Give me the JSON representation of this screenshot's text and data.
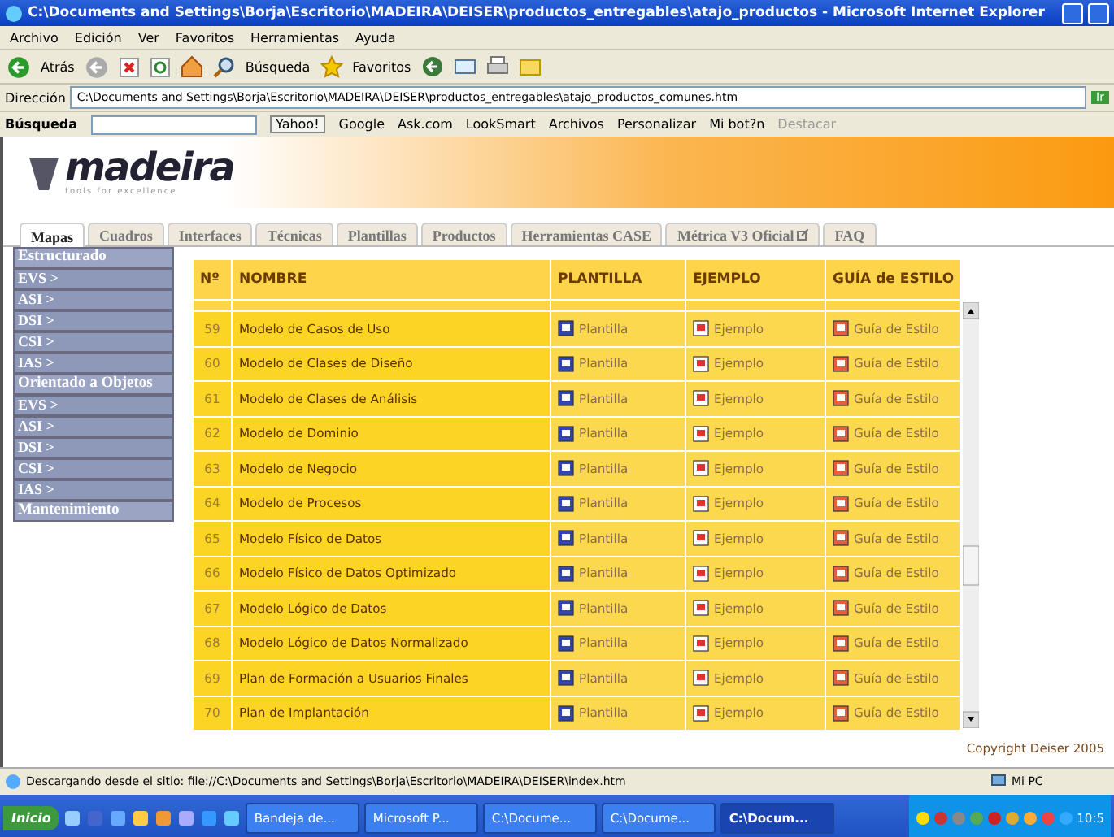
{
  "window": {
    "title": "C:\\Documents and Settings\\Borja\\Escritorio\\MADEIRA\\DEISER\\productos_entregables\\atajo_productos - Microsoft Internet Explorer"
  },
  "menu": [
    "Archivo",
    "Edición",
    "Ver",
    "Favoritos",
    "Herramientas",
    "Ayuda"
  ],
  "toolbar": {
    "back": "Atrás",
    "search": "Búsqueda",
    "favorites": "Favoritos"
  },
  "address": {
    "label": "Dirección",
    "value": "C:\\Documents and Settings\\Borja\\Escritorio\\MADEIRA\\DEISER\\productos_entregables\\atajo_productos_comunes.htm",
    "go": "Ir"
  },
  "search_bar": {
    "label": "Búsqueda",
    "engine": "Yahoo!",
    "links": [
      {
        "label": "Google",
        "disabled": false
      },
      {
        "label": "Ask.com",
        "disabled": false
      },
      {
        "label": "LookSmart",
        "disabled": false
      },
      {
        "label": "Archivos",
        "disabled": false
      },
      {
        "label": "Personalizar",
        "disabled": false
      },
      {
        "label": "Mi bot?n",
        "disabled": false
      },
      {
        "label": "Destacar",
        "disabled": true
      }
    ]
  },
  "logo": {
    "name": "madeira",
    "tagline": "tools for excellence"
  },
  "tabs": [
    {
      "label": "Mapas",
      "selected": true
    },
    {
      "label": "Cuadros",
      "selected": false
    },
    {
      "label": "Interfaces",
      "selected": false
    },
    {
      "label": "Técnicas",
      "selected": false
    },
    {
      "label": "Plantillas",
      "selected": false
    },
    {
      "label": "Productos",
      "selected": false
    },
    {
      "label": "Herramientas CASE",
      "selected": false
    },
    {
      "label": "Métrica V3 Oficial",
      "selected": false,
      "external": true
    },
    {
      "label": "FAQ",
      "selected": false
    }
  ],
  "sidebar": {
    "items": [
      {
        "kind": "header",
        "label": "Estructurado"
      },
      {
        "kind": "link",
        "label": "EVS >"
      },
      {
        "kind": "link",
        "label": "ASI >"
      },
      {
        "kind": "link",
        "label": "DSI >"
      },
      {
        "kind": "link",
        "label": "CSI >"
      },
      {
        "kind": "link",
        "label": "IAS >"
      },
      {
        "kind": "header",
        "label": "Orientado a Objetos"
      },
      {
        "kind": "link",
        "label": "EVS >"
      },
      {
        "kind": "link",
        "label": "ASI >"
      },
      {
        "kind": "link",
        "label": "DSI >"
      },
      {
        "kind": "link",
        "label": "CSI >"
      },
      {
        "kind": "link",
        "label": "IAS >"
      },
      {
        "kind": "header",
        "label": "Mantenimiento"
      }
    ]
  },
  "table": {
    "columns": [
      "Nº",
      "NOMBRE",
      "PLANTILLA",
      "EJEMPLO",
      "GUÍA de ESTILO"
    ],
    "rows": [
      {
        "n": "59",
        "name": "Modelo de Casos de Uso",
        "template": "Plantilla",
        "example": "Ejemplo",
        "guide": "Guía de Estilo"
      },
      {
        "n": "60",
        "name": "Modelo de Clases de Diseño",
        "template": "Plantilla",
        "example": "Ejemplo",
        "guide": "Guía de Estilo"
      },
      {
        "n": "61",
        "name": "Modelo de Clases de Análisis",
        "template": "Plantilla",
        "example": "Ejemplo",
        "guide": "Guía de Estilo"
      },
      {
        "n": "62",
        "name": "Modelo de Dominio",
        "template": "Plantilla",
        "example": "Ejemplo",
        "guide": "Guía de Estilo"
      },
      {
        "n": "63",
        "name": "Modelo de Negocio",
        "template": "Plantilla",
        "example": "Ejemplo",
        "guide": "Guía de Estilo"
      },
      {
        "n": "64",
        "name": "Modelo de Procesos",
        "template": "Plantilla",
        "example": "Ejemplo",
        "guide": "Guía de Estilo"
      },
      {
        "n": "65",
        "name": "Modelo Físico de Datos",
        "template": "Plantilla",
        "example": "Ejemplo",
        "guide": "Guía de Estilo"
      },
      {
        "n": "66",
        "name": "Modelo Físico de Datos Optimizado",
        "template": "Plantilla",
        "example": "Ejemplo",
        "guide": "Guía de Estilo"
      },
      {
        "n": "67",
        "name": "Modelo Lógico de Datos",
        "template": "Plantilla",
        "example": "Ejemplo",
        "guide": "Guía de Estilo"
      },
      {
        "n": "68",
        "name": "Modelo Lógico de Datos Normalizado",
        "template": "Plantilla",
        "example": "Ejemplo",
        "guide": "Guía de Estilo"
      },
      {
        "n": "69",
        "name": "Plan de Formación a Usuarios Finales",
        "template": "Plantilla",
        "example": "Ejemplo",
        "guide": "Guía de Estilo"
      },
      {
        "n": "70",
        "name": "Plan de Implantación",
        "template": "Plantilla",
        "example": "Ejemplo",
        "guide": "Guía de Estilo"
      }
    ]
  },
  "footer": "Copyright Deiser 2005",
  "status_bar": {
    "text": "Descargando desde el sitio: file://C:\\Documents and Settings\\Borja\\Escritorio\\MADEIRA\\DEISER\\index.htm",
    "zone": "Mi PC"
  },
  "taskbar": {
    "start": "Inicio",
    "tasks": [
      {
        "label": "Bandeja de...",
        "selected": false
      },
      {
        "label": "Microsoft P...",
        "selected": false
      },
      {
        "label": "C:\\Docume...",
        "selected": false
      },
      {
        "label": "C:\\Docume...",
        "selected": false
      },
      {
        "label": "C:\\Docum...",
        "selected": true
      }
    ],
    "clock": "10:5"
  }
}
